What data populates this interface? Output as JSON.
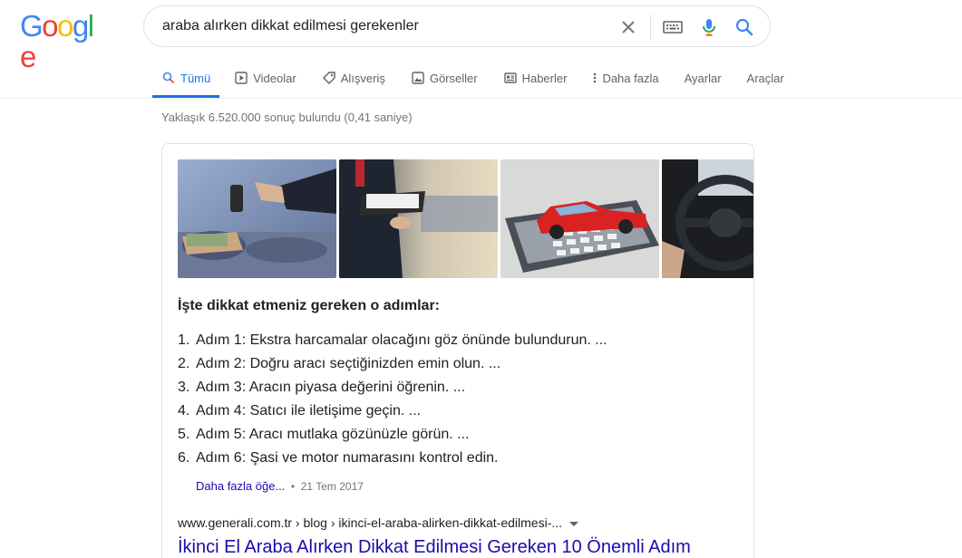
{
  "logo": {
    "letters": [
      "G",
      "o",
      "o",
      "g",
      "l",
      "e"
    ],
    "colors": [
      "#4285f4",
      "#ea4335",
      "#fbbc05",
      "#4285f4",
      "#34a853",
      "#ea4335"
    ]
  },
  "search": {
    "query": "araba alırken dikkat edilmesi gerekenler",
    "clear_icon": "close-icon",
    "keyboard_icon": "keyboard-icon",
    "mic_icon": "microphone-icon",
    "search_icon": "search-icon"
  },
  "tabs": [
    {
      "label": "Tümü",
      "icon": "search-icon",
      "active": true
    },
    {
      "label": "Videolar",
      "icon": "play-icon"
    },
    {
      "label": "Alışveriş",
      "icon": "tag-icon"
    },
    {
      "label": "Görseller",
      "icon": "image-icon"
    },
    {
      "label": "Haberler",
      "icon": "newspaper-icon"
    },
    {
      "label": "Daha fazla",
      "icon": "more-vert-icon"
    },
    {
      "label": "Ayarlar"
    },
    {
      "label": "Araçlar"
    }
  ],
  "stats": "Yaklaşık 6.520.000 sonuç bulundu (0,41 saniye)",
  "snippet": {
    "images": [
      "car-keys-handover-photo",
      "clipboard-inspection-photo",
      "red-car-on-calculator-photo",
      "steering-wheel-photo"
    ],
    "heading": "İşte dikkat etmeniz gereken o adımlar:",
    "steps": [
      {
        "num": "1.",
        "text": "Adım 1: Ekstra harcamalar olacağını göz önünde bulundurun. ..."
      },
      {
        "num": "2.",
        "text": "Adım 2: Doğru aracı seçtiğinizden emin olun. ..."
      },
      {
        "num": "3.",
        "text": "Adım 3: Aracın piyasa değerini öğrenin. ..."
      },
      {
        "num": "4.",
        "text": "Adım 4: Satıcı ile iletişime geçin. ..."
      },
      {
        "num": "5.",
        "text": "Adım 5: Aracı mutlaka gözünüzle görün. ..."
      },
      {
        "num": "6.",
        "text": "Adım 6: Şasi ve motor numarasını kontrol edin."
      }
    ],
    "more_label": "Daha fazla öğe...",
    "separator": "•",
    "date": "21 Tem 2017",
    "url": "www.generali.com.tr › blog › ikinci-el-araba-alirken-dikkat-edilmesi-...",
    "title": "İkinci El Araba Alırken Dikkat Edilmesi Gereken 10 Önemli Adım"
  },
  "colors": {
    "accent": "#1a73e8",
    "link": "#1a0dab",
    "muted": "#70757a"
  }
}
